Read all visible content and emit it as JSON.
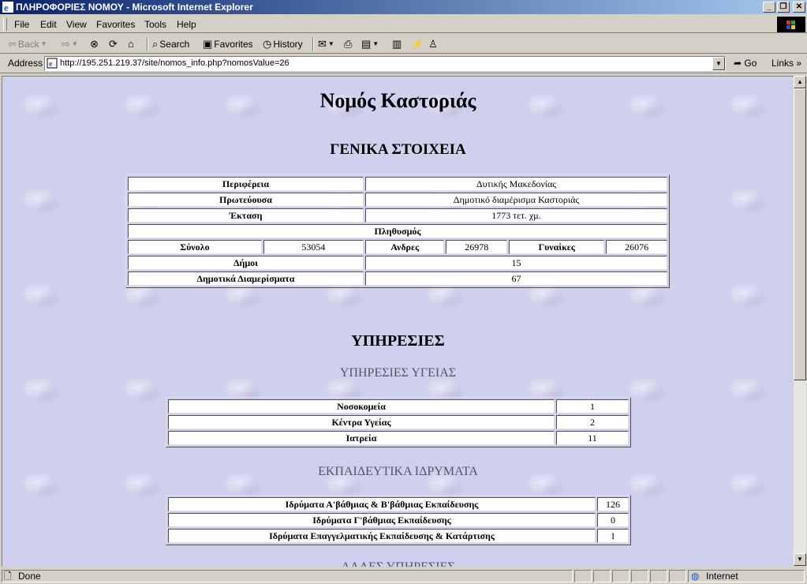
{
  "window": {
    "title": "ΠΛΗΡΟΦΟΡΙΕΣ ΝΟΜΟΥ - Microsoft Internet Explorer",
    "buttons": {
      "minimize": "_",
      "maximize": "❐",
      "close": "✕"
    }
  },
  "menu": [
    "File",
    "Edit",
    "View",
    "Favorites",
    "Tools",
    "Help"
  ],
  "toolbar": {
    "back": "Back",
    "forward": "",
    "search": "Search",
    "favorites": "Favorites",
    "history": "History"
  },
  "address": {
    "label": "Address",
    "url": "http://195.251.219.37/site/nomos_info.php?nomosValue=26",
    "go": "Go",
    "links": "Links"
  },
  "page": {
    "title": "Νομός Καστοριάς",
    "general": {
      "heading": "ΓΕΝΙΚΑ ΣΤΟΙΧΕΙΑ",
      "periphery_label": "Περιφέρεια",
      "periphery_value": "Δυτικής Μακεδονίας",
      "capital_label": "Πρωτεύουσα",
      "capital_value": "Δημοτικό διαμέρισμα Καστοριάς",
      "area_label": "Έκταση",
      "area_value": "1773 τετ. χμ.",
      "population_label": "Πληθυσμός",
      "total_label": "Σύνολο",
      "total_value": "53054",
      "men_label": "Ανδρες",
      "men_value": "26978",
      "women_label": "Γυναίκες",
      "women_value": "26076",
      "municipalities_label": "Δήμοι",
      "municipalities_value": "15",
      "districts_label": "Δημοτικά Διαμερίσματα",
      "districts_value": "67"
    },
    "services": {
      "heading": "ΥΠΗΡΕΣΙΕΣ",
      "health_heading": "ΥΠΗΡΕΣΙΕΣ ΥΓΕΙΑΣ",
      "health_rows": [
        {
          "label": "Νοσοκομεία",
          "value": "1"
        },
        {
          "label": "Κέντρα Υγείας",
          "value": "2"
        },
        {
          "label": "Ιατρεία",
          "value": "11"
        }
      ],
      "education_heading": "ΕΚΠΑΙΔΕΥΤΙΚΑ ΙΔΡΥΜΑΤΑ",
      "education_rows": [
        {
          "label": "Ιδρύματα Α'βάθμιας & Β'βάθμιας Εκπαίδευσης",
          "value": "126"
        },
        {
          "label": "Ιδρύματα Γ'βάθμιας Εκπαίδευσης",
          "value": "0"
        },
        {
          "label": "Ιδρύματα Επαγγελματικής Εκπαίδευσης & Κατάρτισης",
          "value": "1"
        }
      ],
      "next_heading_partial": "ΑΛΛΕΣ ΥΠΗΡΕΣΙΕΣ"
    }
  },
  "status": {
    "text": "Done",
    "zone": "Internet"
  }
}
